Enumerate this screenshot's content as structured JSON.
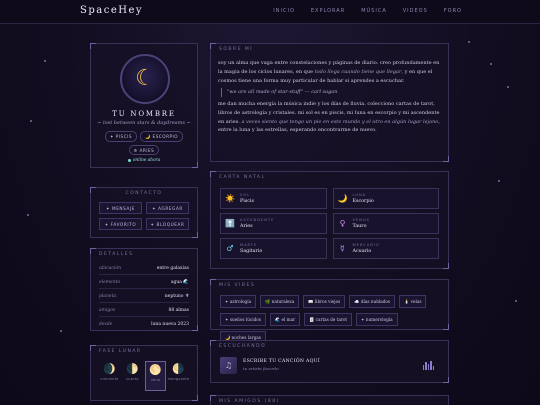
{
  "header": {
    "logo": "SpaceHey",
    "nav": [
      "INICIO",
      "EXPLORAR",
      "MÚSICA",
      "VIDEOS",
      "FORO"
    ]
  },
  "profile": {
    "name": "TU NOMBRE",
    "tagline": "~ lost between stars & daydreams ~",
    "avatar_icon": "crescent-moon-icon",
    "badges": [
      "✦ PISCIS",
      "🌙 ESCORPIO",
      "⟰ ARIES"
    ],
    "status": "online ahora"
  },
  "contacto": {
    "title": "CONTACTO",
    "buttons": [
      "✦ MENSAJE",
      "✦ AGREGAR",
      "✦ FAVORITO",
      "✦ BLOQUEAR"
    ]
  },
  "detalles": {
    "title": "DETALLES",
    "rows": [
      {
        "k": "ubicación",
        "v": "entre galaxias"
      },
      {
        "k": "elemento",
        "v": "agua 🌊"
      },
      {
        "k": "planeta",
        "v": "neptuno ♆"
      },
      {
        "k": "amigos",
        "v": "88 almas"
      },
      {
        "k": "desde",
        "v": "luna nueva 2023"
      }
    ]
  },
  "lunar": {
    "title": "FASE LUNAR",
    "phases": [
      {
        "glyph": "🌒",
        "label": "creciente"
      },
      {
        "glyph": "🌓",
        "label": "cuarto"
      },
      {
        "glyph": "🌕",
        "label": "llena"
      },
      {
        "glyph": "🌗",
        "label": "menguante"
      }
    ],
    "active_index": 2
  },
  "sobre": {
    "title": "SOBRE MÍ",
    "p1_a": "soy un alma que vaga entre constelaciones y páginas de diario. creo profundamente en la magia de los ciclos lunares, en que ",
    "p1_em": "todo llega cuando tiene que llegar",
    "p1_b": ", y en que el cosmos tiene una forma muy particular de hablar si aprendes a escuchar.",
    "quote": "\"we are all made of star-stuff\" — carl sagan",
    "p2_a": "me dan mucha energía la música indie y los días de lluvia. colecciono cartas de tarot, libros de astrología y cristales. mi sol es en piscis, mi luna en escorpio y mi ascendente en aries. ",
    "p2_em": "a veces siento que tengo un pie en este mundo y el otro en algún lugar lejano",
    "p2_b": ", entre la luna y las estrellas, esperando encontrarme de nuevo."
  },
  "carta": {
    "title": "CARTA NATAL",
    "items": [
      {
        "icon": "☀️",
        "k": "SOL",
        "v": "Piscis",
        "color": "#f5c24b"
      },
      {
        "icon": "🌙",
        "k": "LUNA",
        "v": "Escorpio",
        "color": "#f5c24b"
      },
      {
        "icon": "⬆️",
        "k": "ASCENDENTE",
        "v": "Aries",
        "color": "#7fb4e6"
      },
      {
        "icon": "♀",
        "k": "VENUS",
        "v": "Tauro",
        "color": "#c58cf0"
      },
      {
        "icon": "♂",
        "k": "MARTE",
        "v": "Sagitario",
        "color": "#6fd0e6"
      },
      {
        "icon": "☿",
        "k": "MERCURIO",
        "v": "Acuario",
        "color": "#c58cf0"
      }
    ]
  },
  "vibes": {
    "title": "MIS VIBES",
    "tags": [
      "✦ astrología",
      "🌿 naturaleza",
      "📖 libros viejos",
      "☁️ días nublados",
      "🕯️ velas",
      "✦ sueños lúcidos",
      "🌊 el mar",
      "🃏 cartas de tarot",
      "✦ numerología",
      "🌙 noches largas"
    ]
  },
  "escuchando": {
    "title": "ESCUCHANDO",
    "track": "ESCRIBE TU CANCIÓN AQUÍ",
    "artist": "tu artista favorito"
  },
  "next_panel": {
    "title": "MIS AMIGOS (88)"
  }
}
